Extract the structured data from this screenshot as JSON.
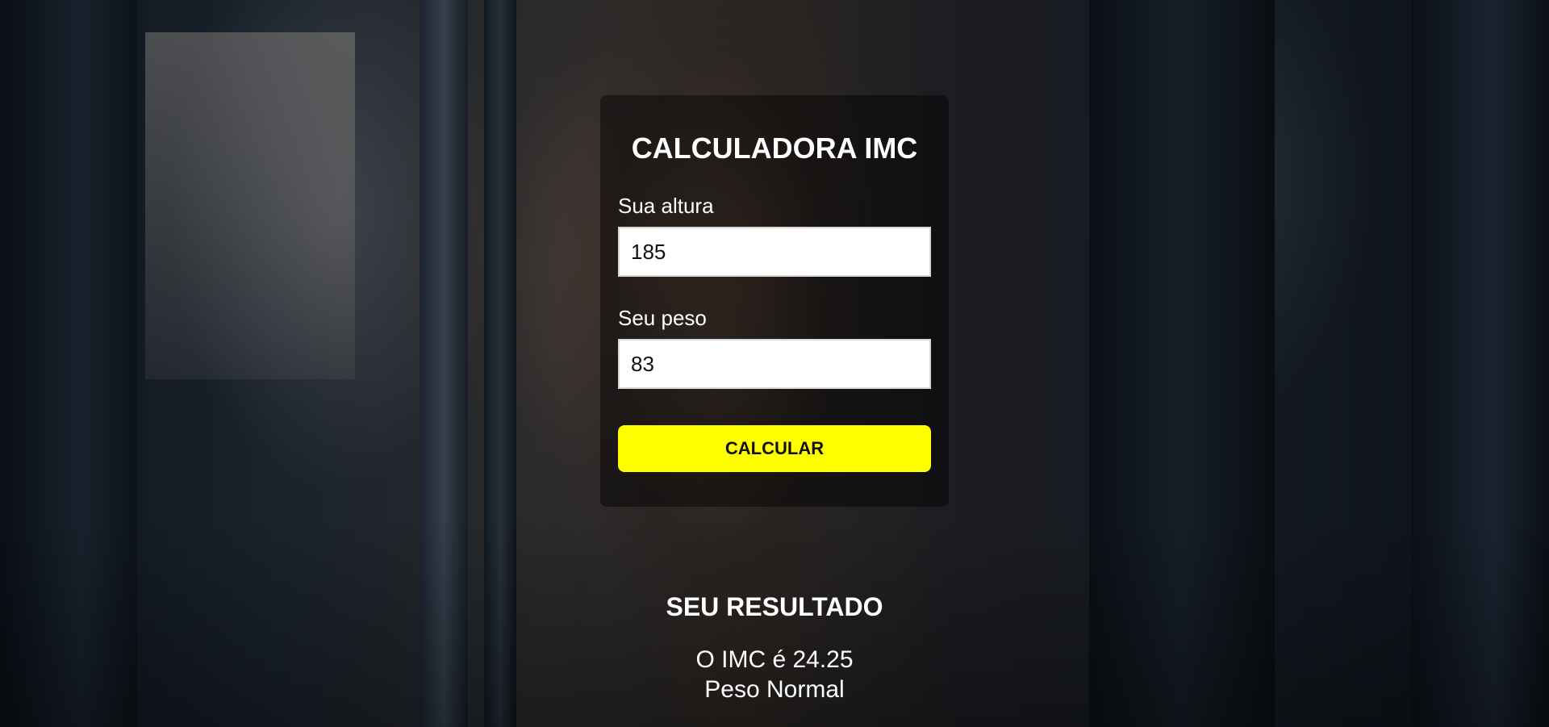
{
  "calculator": {
    "title": "CALCULADORA IMC",
    "height_label": "Sua altura",
    "height_value": "185",
    "weight_label": "Seu peso",
    "weight_value": "83",
    "button_label": "CALCULAR"
  },
  "result": {
    "title": "SEU RESULTADO",
    "value_text": "O IMC é 24.25",
    "classification": "Peso Normal"
  },
  "colors": {
    "button_bg": "#ffff00",
    "text": "#ffffff",
    "card_bg": "rgba(0,0,0,0.45)"
  }
}
